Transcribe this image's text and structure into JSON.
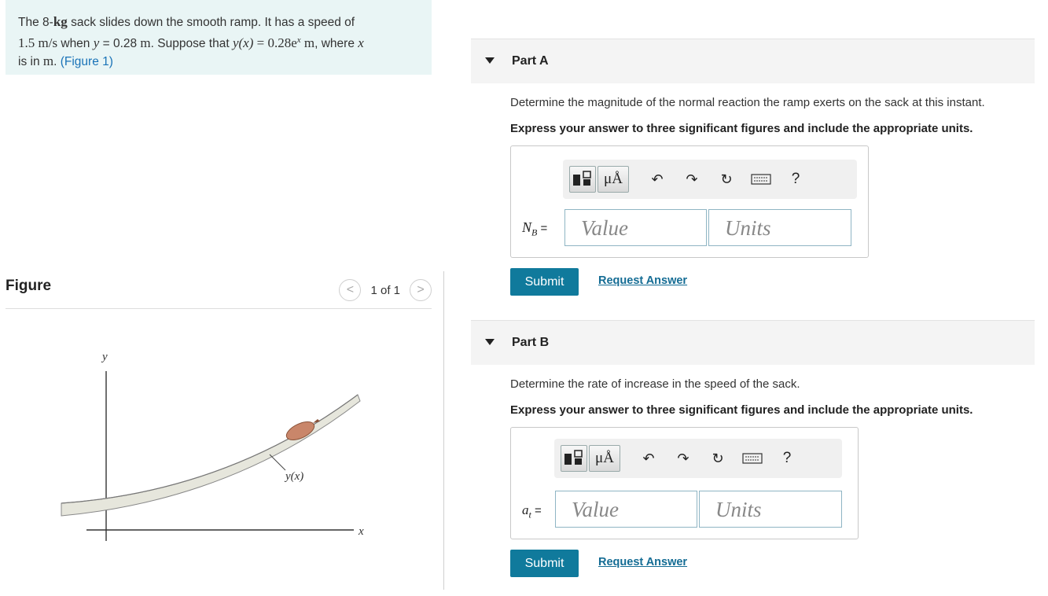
{
  "problem": {
    "t1": "The 8-",
    "kg": "kg",
    "t2": " sack slides down the smooth ramp. It has a speed of",
    "speed": "1.5 m/s",
    "t3": " when ",
    "y": "y",
    "t4": " = 0.28 ",
    "m1": "m",
    "t5": ". Suppose that ",
    "yx": "y(x)",
    "t6": " = ",
    "func": "0.28e",
    "sup": "x",
    "t7": " m",
    "t8": ", where ",
    "x": "x",
    "t9": "is in ",
    "m2": "m",
    "t10": ". ",
    "fig_link": "(Figure 1)"
  },
  "figure": {
    "title": "Figure",
    "prev": "<",
    "next": ">",
    "count": "1 of 1",
    "y_axis": "y",
    "x_axis": "x",
    "curve_label": "y(x)"
  },
  "toolbar": {
    "mu": "μÅ",
    "undo": "↶",
    "redo": "↷",
    "reset": "↻",
    "help": "?"
  },
  "partA": {
    "label": "Part A",
    "question": "Determine the magnitude of the normal reaction the ramp exerts on the sack at this instant.",
    "instruction": "Express your answer to three significant figures and include the appropriate units.",
    "var": "N",
    "sub": "B",
    "eq": " =",
    "value_placeholder": "Value",
    "units_placeholder": "Units",
    "submit": "Submit",
    "request": "Request Answer"
  },
  "partB": {
    "label": "Part B",
    "question": "Determine the rate of increase in the speed of the sack.",
    "instruction": "Express your answer to three significant figures and include the appropriate units.",
    "var": "a",
    "sub": "t",
    "eq": " =",
    "value_placeholder": "Value",
    "units_placeholder": "Units",
    "submit": "Submit",
    "request": "Request Answer"
  }
}
